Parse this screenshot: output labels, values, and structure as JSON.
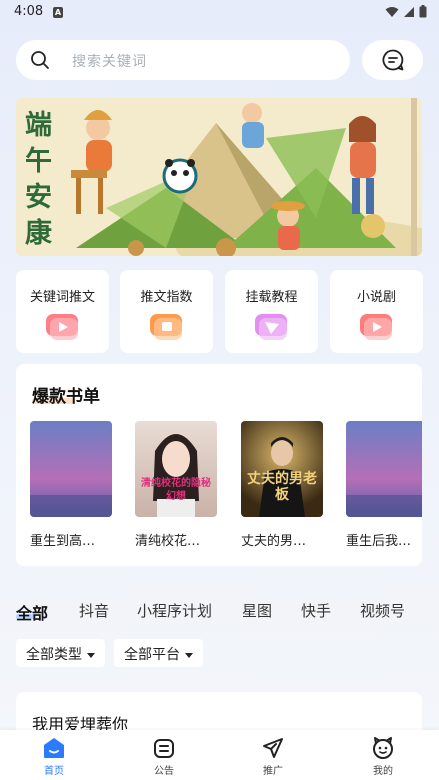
{
  "status_bar": {
    "time": "4:08",
    "notification_letter": "A"
  },
  "search": {
    "placeholder": "搜索关键词"
  },
  "banner": {
    "title": "端午安康"
  },
  "categories": [
    {
      "label": "关键词推文"
    },
    {
      "label": "推文指数"
    },
    {
      "label": "挂载教程"
    },
    {
      "label": "小说剧"
    }
  ],
  "hot_list": {
    "title": "爆款书单",
    "books": [
      {
        "title": "重生到高…",
        "cover_text": ""
      },
      {
        "title": "清纯校花…",
        "cover_text": "清纯校花的隐秘幻想"
      },
      {
        "title": "丈夫的男…",
        "cover_text": "丈夫的男老板"
      },
      {
        "title": "重生后我…",
        "cover_text": ""
      }
    ]
  },
  "tabs": [
    {
      "label": "全部"
    },
    {
      "label": "抖音"
    },
    {
      "label": "小程序计划"
    },
    {
      "label": "星图"
    },
    {
      "label": "快手"
    },
    {
      "label": "视频号"
    }
  ],
  "filters": [
    {
      "label": "全部类型"
    },
    {
      "label": "全部平台"
    }
  ],
  "result": {
    "title": "我用爱埋葬你"
  },
  "bottom_nav": [
    {
      "label": "首页",
      "icon": "home-icon"
    },
    {
      "label": "公告",
      "icon": "announcement-icon"
    },
    {
      "label": "推广",
      "icon": "send-icon"
    },
    {
      "label": "我的",
      "icon": "profile-icon"
    }
  ],
  "colors": {
    "accent": "#2b7bff",
    "banner_title": "#2f6b3a"
  }
}
